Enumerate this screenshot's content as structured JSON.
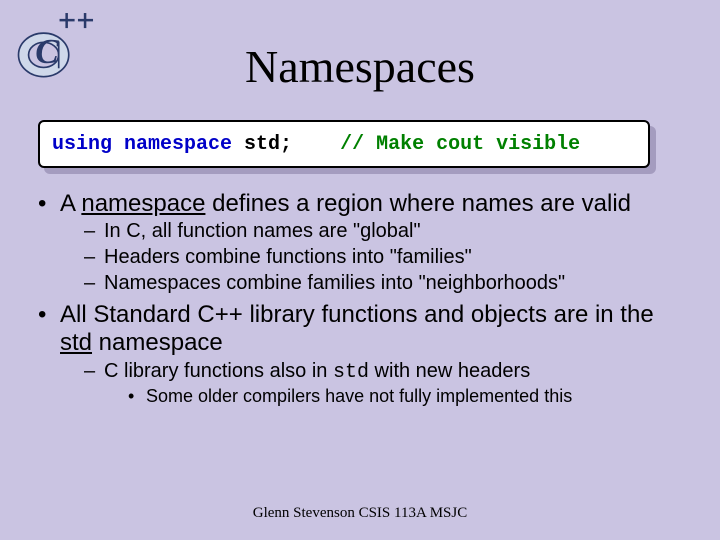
{
  "title": "Namespaces",
  "code": {
    "kw_using": "using ",
    "kw_namespace": "namespace ",
    "ident": "std;",
    "gap": "    ",
    "comment": "// Make cout visible"
  },
  "bullets": {
    "b1_pre": "A ",
    "b1_u": "namespace",
    "b1_post": " defines a region where names are valid",
    "b1_s1": "In C, all function names are \"global\"",
    "b1_s2": "Headers combine functions into \"families\"",
    "b1_s3": "Namespaces combine families into \"neighborhoods\"",
    "b2_pre": "All Standard C++ library functions and objects are in the ",
    "b2_u": "std",
    "b2_post": " namespace",
    "b2_s1_pre": "C library functions also in ",
    "b2_s1_mono": "std",
    "b2_s1_post": " with new headers",
    "b2_s1_s1": "Some older compilers have not fully implemented this"
  },
  "footer": "Glenn Stevenson CSIS 113A MSJC"
}
